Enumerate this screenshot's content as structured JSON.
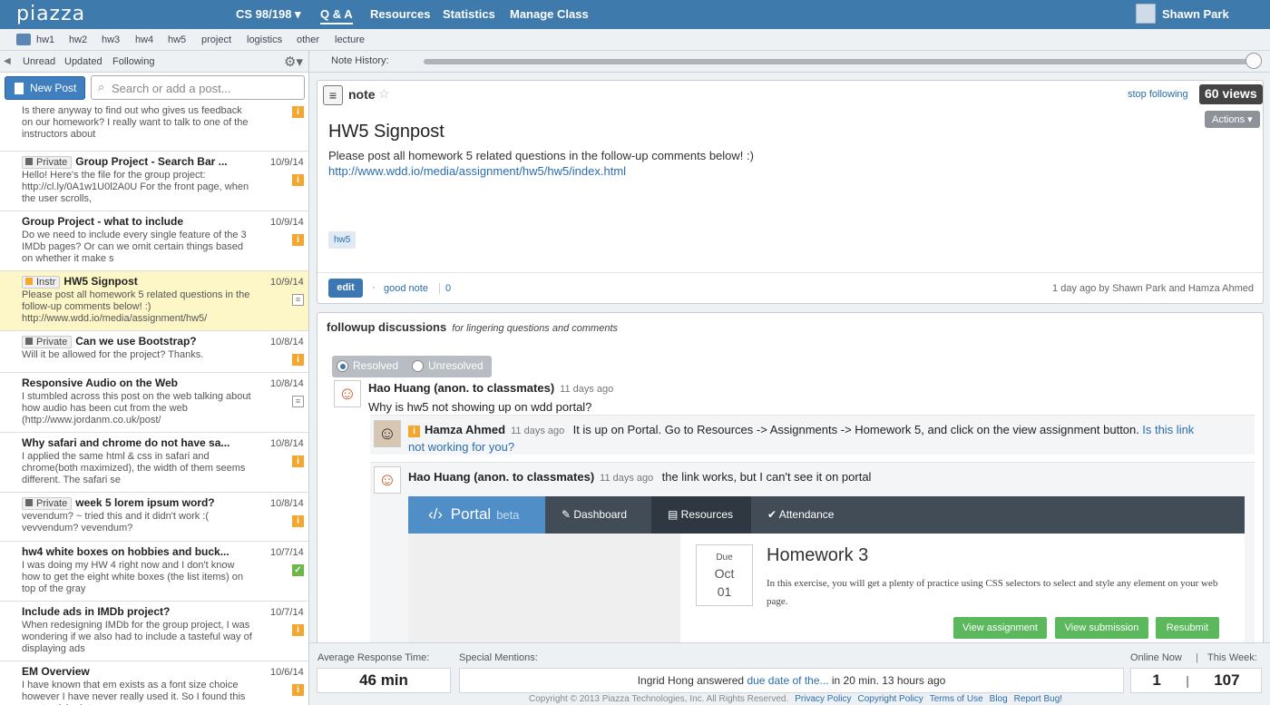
{
  "header": {
    "logo": "piazza",
    "class_name": "CS 98/198 ▾",
    "nav": [
      "Q & A",
      "Resources",
      "Statistics",
      "Manage Class"
    ],
    "user": "Shawn Park"
  },
  "folders": [
    "hw1",
    "hw2",
    "hw3",
    "hw4",
    "hw5",
    "project",
    "logistics",
    "other",
    "lecture"
  ],
  "filters": [
    "Unread",
    "Updated",
    "Following"
  ],
  "note_history_label": "Note History:",
  "new_post_label": "New Post",
  "search_placeholder": "Search or add a post...",
  "feed": [
    {
      "tag": "",
      "title": "",
      "snippet": "Is there anyway to find out who gives us feedback on our homework? I really want to talk to one of the instructors about",
      "date": "",
      "badge": "i"
    },
    {
      "tag": "Private",
      "title": "Group Project - Search Bar ...",
      "snippet": "Hello! Here's the file for the group project: http://cl.ly/0A1w1U0l2A0U For the front page, when the user scrolls,",
      "date": "10/9/14",
      "badge": "i"
    },
    {
      "tag": "",
      "title": "Group Project - what to include",
      "snippet": "Do we need to include every single feature of the 3 IMDb pages? Or can we omit certain things based on whether it make s",
      "date": "10/9/14",
      "badge": "i"
    },
    {
      "tag": "Instr",
      "title": "HW5 Signpost",
      "snippet": "Please post all homework 5 related questions in the follow-up comments below! :) http://www.wdd.io/media/assignment/hw5/",
      "date": "10/9/14",
      "badge": "note",
      "selected": true
    },
    {
      "tag": "Private",
      "title": "Can we use Bootstrap?",
      "snippet": "Will it be allowed for the project? Thanks.",
      "date": "10/8/14",
      "badge": "i"
    },
    {
      "tag": "",
      "title": "Responsive Audio on the Web",
      "snippet": "I stumbled across this post on the web talking about how audio has been cut from the web (http://www.jordanm.co.uk/post/",
      "date": "10/8/14",
      "badge": "note"
    },
    {
      "tag": "",
      "title": "Why safari and chrome do not have sa...",
      "snippet": "I applied the same html & css in safari and chrome(both maximized), the width of them seems different. The safari se",
      "date": "10/8/14",
      "badge": "i"
    },
    {
      "tag": "Private",
      "title": "week 5 lorem ipsum word?",
      "snippet": "vevendum? ~ tried this and it didn't work :( vevvendum? vevendum?",
      "date": "10/8/14",
      "badge": "i"
    },
    {
      "tag": "",
      "title": "hw4 white boxes on hobbies and buck...",
      "snippet": "I was doing my HW 4 right now and I don't know how to get the eight white boxes (the list items) on top of the gray",
      "date": "10/7/14",
      "badge": "check"
    },
    {
      "tag": "",
      "title": "Include ads in IMDb project?",
      "snippet": "When redesigning IMDb for the group project, I was wondering if we also had to include a tasteful way of displaying ads",
      "date": "10/7/14",
      "badge": "i"
    },
    {
      "tag": "",
      "title": "EM Overview",
      "snippet": "I have known that em exists as a font size choice however I have never really used it. So I found this great article det",
      "date": "10/6/14",
      "badge": "i"
    }
  ],
  "note": {
    "type": "note",
    "stop_following": "stop following",
    "views": "60 views",
    "actions": "Actions ▾",
    "title": "HW5 Signpost",
    "body": "Please post all homework 5 related questions in the follow-up comments below! :)",
    "link": "http://www.wdd.io/media/assignment/hw5/hw5/index.html",
    "tag": "hw5",
    "edit": "edit",
    "good_note": "good note",
    "good_note_count": "0",
    "meta": "1 day ago by Shawn Park and Hamza Ahmed"
  },
  "followup": {
    "title": "followup discussions",
    "subtitle": "for lingering questions and comments",
    "resolved": "Resolved",
    "unresolved": "Unresolved",
    "c1_author": "Hao Huang (anon. to classmates)",
    "c1_ago": "11 days ago",
    "c1_text": "Why is hw5 not showing up on wdd portal?",
    "r1_author": "Hamza Ahmed",
    "r1_ago": "11 days ago",
    "r1_text": "It is up on Portal. Go to Resources -> Assignments -> Homework 5, and click on the view assignment button.",
    "r1_link": "Is this link not working for you?",
    "r2_author": "Hao Huang (anon. to classmates)",
    "r2_ago": "11 days ago",
    "r2_text": "the link works,  but I can't see it on portal"
  },
  "portal": {
    "logo": "Portal",
    "beta": "beta",
    "tabs": [
      "Dashboard",
      "Resources",
      "Attendance"
    ],
    "due_label": "Due",
    "due_date": "Oct",
    "due_day": "01",
    "hw_title": "Homework 3",
    "hw_desc": "In this exercise, you will get a plenty of practice using CSS selectors to select and style any element on your web page.",
    "buttons": [
      "View assignment",
      "View submission",
      "Resubmit"
    ]
  },
  "status": {
    "avg_label": "Average Response Time:",
    "avg_value": "46 min",
    "mentions_label": "Special Mentions:",
    "mention_pre": "Ingrid Hong answered",
    "mention_link": "due date of the...",
    "mention_post": "in 20 min. 13 hours ago",
    "online_label": "Online Now",
    "week_label": "This Week:",
    "online_value": "1",
    "week_value": "107"
  },
  "footer": {
    "copyright": "Copyright © 2013 Piazza Technologies, Inc. All Rights Reserved.",
    "links": [
      "Privacy Policy",
      "Copyright Policy",
      "Terms of Use",
      "Blog",
      "Report Bug!"
    ]
  }
}
